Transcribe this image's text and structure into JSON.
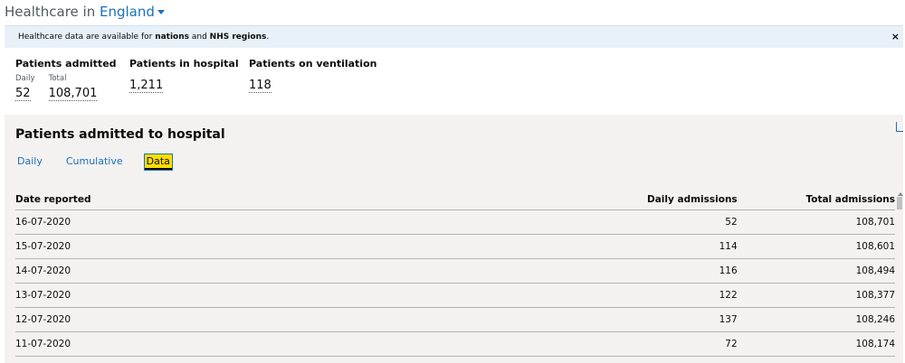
{
  "header": {
    "prefix": "Healthcare in",
    "region": "England"
  },
  "banner": {
    "text_before": "Healthcare data are available for ",
    "link1": "nations",
    "text_mid": " and ",
    "link2": "NHS regions",
    "text_after": ".",
    "close": "×"
  },
  "stats": {
    "admitted": {
      "title": "Patients admitted",
      "daily_label": "Daily",
      "daily": "52",
      "total_label": "Total",
      "total": "108,701"
    },
    "hospital": {
      "title": "Patients in hospital",
      "value": "1,211"
    },
    "ventilation": {
      "title": "Patients on ventilation",
      "value": "118"
    }
  },
  "card": {
    "title": "Patients admitted to hospital",
    "tabs": [
      "Daily",
      "Cumulative",
      "Data"
    ],
    "active_tab": "Data",
    "columns": [
      "Date reported",
      "Daily admissions",
      "Total admissions"
    ],
    "rows": [
      [
        "16-07-2020",
        "52",
        "108,701"
      ],
      [
        "15-07-2020",
        "114",
        "108,601"
      ],
      [
        "14-07-2020",
        "116",
        "108,494"
      ],
      [
        "13-07-2020",
        "122",
        "108,377"
      ],
      [
        "12-07-2020",
        "137",
        "108,246"
      ],
      [
        "11-07-2020",
        "72",
        "108,174"
      ]
    ]
  },
  "colors": {
    "link": "#1d70b8",
    "highlight": "#ffdd00",
    "banner": "#e8f1f8",
    "card": "#f3f2f1"
  }
}
